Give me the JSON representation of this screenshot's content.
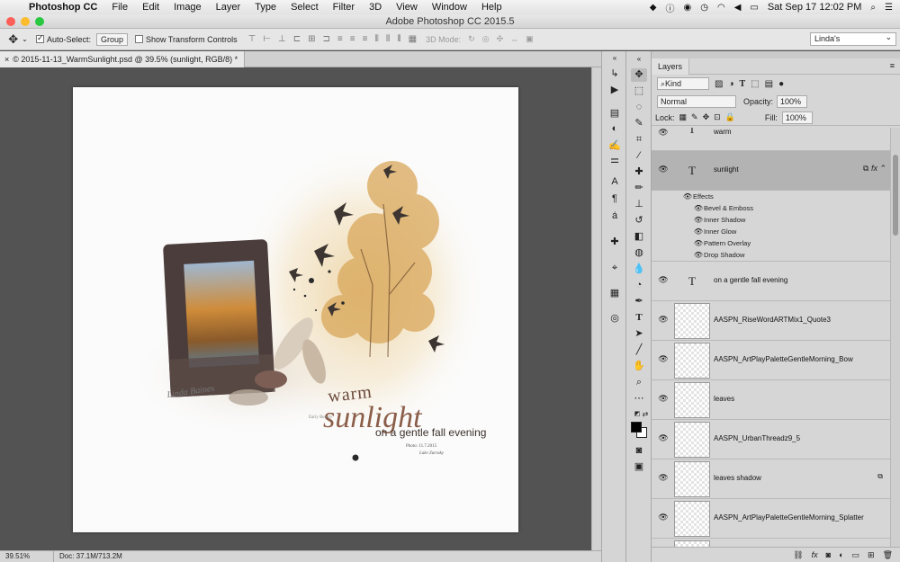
{
  "menubar": {
    "app_name": "Photoshop CC",
    "items": [
      "File",
      "Edit",
      "Image",
      "Layer",
      "Type",
      "Select",
      "Filter",
      "3D",
      "View",
      "Window",
      "Help"
    ],
    "clock": "Sat Sep 17  12:02 PM"
  },
  "window": {
    "title": "Adobe Photoshop CC 2015.5"
  },
  "options": {
    "auto_select_label": "Auto-Select:",
    "auto_select_value": "Group",
    "transform_label": "Show Transform Controls",
    "mode3d_label": "3D Mode:",
    "workspace": "Linda's"
  },
  "document": {
    "tab_title": "© 2015-11-13_WarmSunlight.psd @ 39.5% (sunlight, RGB/8) *",
    "close": "×"
  },
  "artwork": {
    "signature": "Linda Baines",
    "warm_text": "warm",
    "sunlight_text": "sunlight",
    "subtitle_text": "on a gentle fall evening",
    "credit_1": "Photo: 11.7.2015",
    "credit_2": "Lake Zurnsky",
    "caption": "Early Beauty"
  },
  "status": {
    "zoom": "39.51%",
    "doc": "Doc: 37.1M/713.2M"
  },
  "layers_panel": {
    "title": "Layers",
    "filter_kind": "Kind",
    "blend_mode": "Normal",
    "opacity_label": "Opacity:",
    "opacity_value": "100%",
    "lock_label": "Lock:",
    "fill_label": "Fill:",
    "fill_value": "100%",
    "layer_warm": "warm",
    "layer_sunlight": "sunlight",
    "effects_label": "Effects",
    "effects": [
      "Bevel & Emboss",
      "Inner Shadow",
      "Inner Glow",
      "Pattern Overlay",
      "Drop Shadow"
    ],
    "layer_gentle": "on a   gentle fall evening",
    "layer_quote": "AASPN_RiseWordARTMix1_Quote3",
    "layer_bow": "AASPN_ArtPlayPaletteGentleMorning_Bow",
    "layer_leaves": "leaves",
    "layer_threadz": "AASPN_UrbanThreadz9_5",
    "layer_leaves_shadow": "leaves shadow",
    "layer_splatter": "AASPN_ArtPlayPaletteGentleMorning_Splatter",
    "fx_label": "fx"
  },
  "colors": {
    "selected_layer": "#b3b3b3",
    "panel_bg": "#d6d6d6",
    "canvas_bg": "#535353"
  }
}
